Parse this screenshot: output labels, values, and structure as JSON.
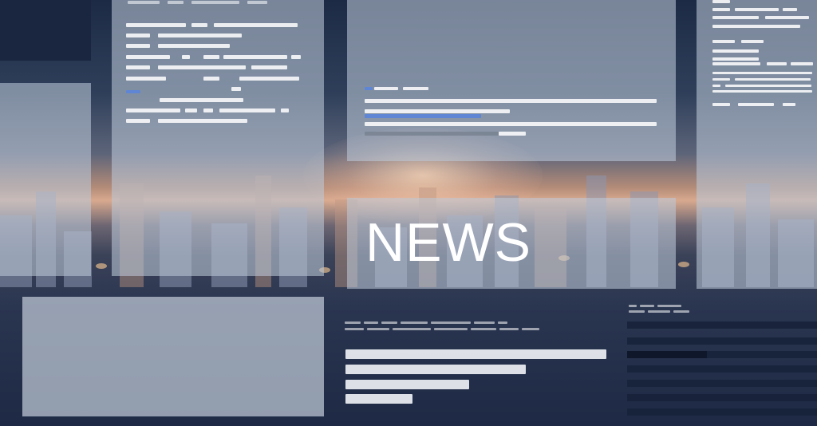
{
  "hero": {
    "headline": "NEWS"
  },
  "colors": {
    "background_dark": "#1c2a45",
    "sunset_glow": "#d8a98e",
    "frosted_panel": "#bcc8d8",
    "accent_blue_line": "#5f86d4",
    "headline_text": "#ffffff"
  }
}
